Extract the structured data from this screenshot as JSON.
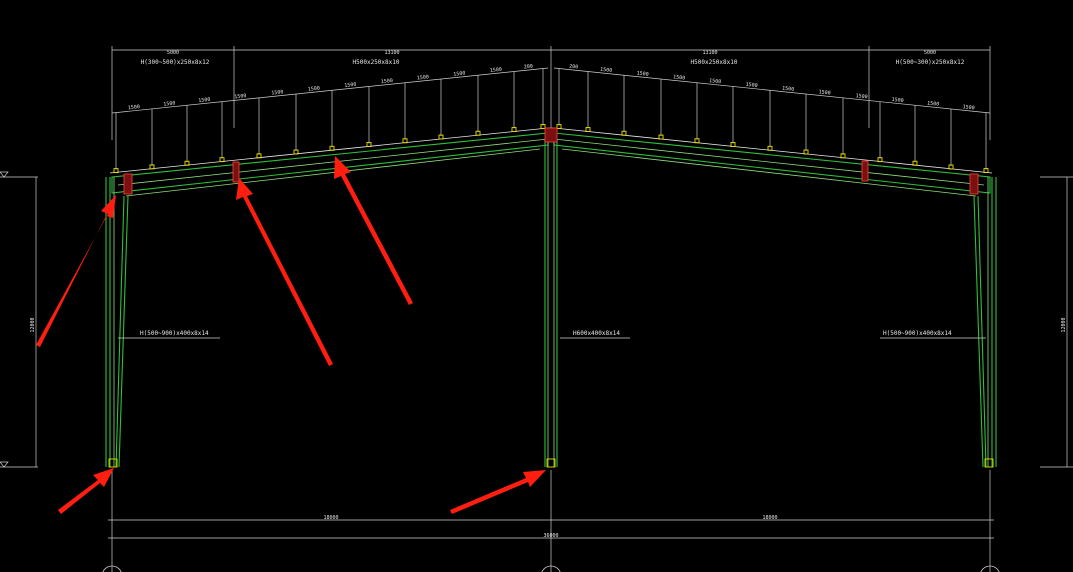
{
  "drawing": {
    "top_spans": [
      "5000",
      "13100",
      "13100",
      "5000"
    ],
    "beams": [
      "H(300~500)x250x8x12",
      "H500x250x8x10",
      "H500x250x8x10",
      "H(500~300)x250x8x12"
    ],
    "columns": [
      "H(500~900)x400x8x14",
      "H600x400x8x14",
      "H(500~900)x400x8x14"
    ],
    "height_dim": "12000",
    "bay_spans": [
      "18000",
      "18000"
    ],
    "total_span": "36000",
    "purlin_spacing": "1500",
    "ridge_spacing": "200",
    "colors": {
      "background": "#000000",
      "member": "#2fbf3a",
      "purlin": "#e8e000",
      "joint": "#ff4040",
      "annotation_arrow": "#ff1e10",
      "dimension": "#cfcfcf"
    }
  }
}
